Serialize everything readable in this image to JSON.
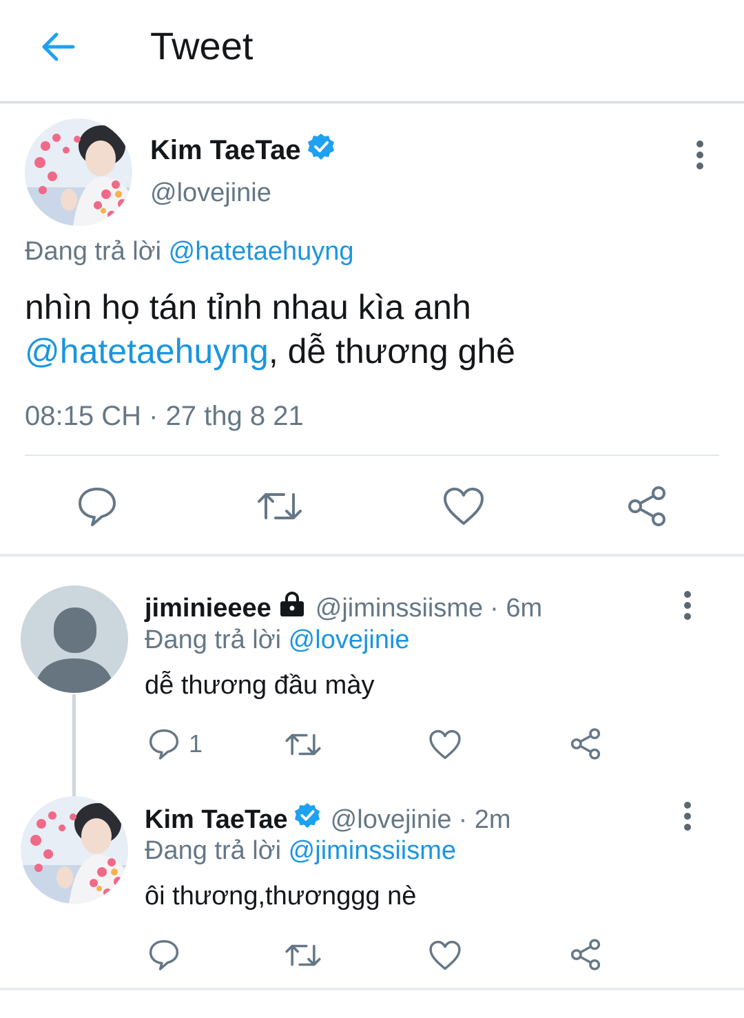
{
  "header": {
    "title": "Tweet",
    "back_icon": "arrow-left-icon",
    "accent": "#1da1f2"
  },
  "main_tweet": {
    "author_name": "Kim TaeTae",
    "handle": "@lovejinie",
    "verified": true,
    "reply_prefix": "Đang trả lời",
    "reply_to": "@hatetaehuyng",
    "text_part1": "nhìn họ tán tỉnh nhau kìa anh",
    "text_mention": "@hatetaehuyng",
    "text_part2": ", dễ thương ghê",
    "timestamp": "08:15 CH · 27 thg 8 21",
    "actions": [
      "reply-icon",
      "retweet-icon",
      "like-icon",
      "share-icon"
    ]
  },
  "replies": [
    {
      "author_name": "jiminieeee",
      "locked": true,
      "handle": "@jiminssiisme",
      "time": "· 6m",
      "reply_prefix": "Đang trả lời",
      "reply_to": "@lovejinie",
      "text": "dễ thương đầu mày",
      "reply_count": "1"
    },
    {
      "author_name": "Kim TaeTae",
      "verified": true,
      "handle": "@lovejinie",
      "time": "· 2m",
      "reply_prefix": "Đang trả lời",
      "reply_to": "@jiminssiisme",
      "text": "ôi thương,thươnggg nè",
      "reply_count": ""
    }
  ],
  "colors": {
    "link": "#1b95e0",
    "muted": "#657786",
    "text": "#14171a",
    "verified": "#1da1f2"
  }
}
